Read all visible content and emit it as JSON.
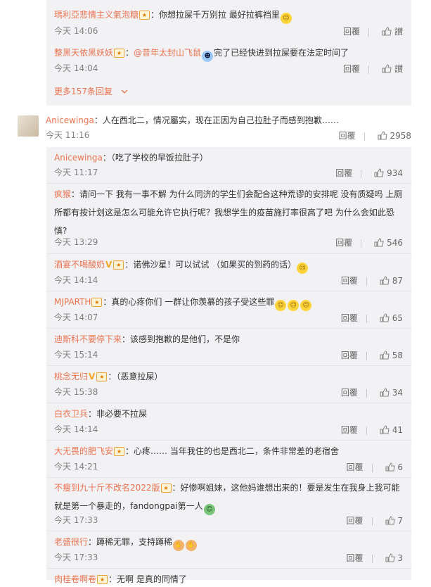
{
  "top_replies": [
    {
      "name": "瑪利亞悲情主义氣泡糖",
      "text": "：你想拉屎千万别拉 最好拉裤裆里",
      "time": "今天 14:06",
      "reply": "回覆",
      "like": "讃"
    },
    {
      "name": "整黑天依黑妖妖",
      "mention": "@昔年太封山飞鼠",
      "text": "完了已经快进到拉屎要在法定时间了",
      "time": "今天 14:04",
      "reply": "回覆",
      "like": "讃"
    }
  ],
  "more_replies": "更多157条回复",
  "main_comment": {
    "name": "Anicewinga",
    "text": "：人在西北二，情况屬实，现在正因为自己拉肚子而感到抱歉……",
    "time": "今天 11:16",
    "reply": "回覆",
    "likes": "2958"
  },
  "sub_replies": [
    {
      "name": "Anicewinga",
      "text": "：（吃了学校的早饭拉肚子）",
      "time": "今天 11:17",
      "reply": "回覆",
      "likes": "934"
    },
    {
      "name": "疯猴",
      "text": "：请问一下 我有一事不解 为什么同济的学生们会配合这种荒谬的安排呢 没有质疑吗 上厕所都有按计划这是怎么可能允许它执行呢？我想学生的疫苗施打率很高了吧 为什么会如此恐慎?",
      "time": "今天 13:29",
      "reply": "回覆",
      "likes": "546"
    },
    {
      "name": "酒宴不喝酸奶",
      "text": "：诺佛沙星！可以试试 （如果买的到药的话）",
      "time": "今天 14:14",
      "reply": "回覆",
      "likes": "87"
    },
    {
      "name": "MJPARTH",
      "text": "：真的心疼你们 一群让你羡慕的孩子受这些罪",
      "time": "今天 14:07",
      "reply": "回覆",
      "likes": "65"
    },
    {
      "name": "迪斯科不要停下来",
      "text": "：该感到抱歉的是他们，不是你",
      "time": "今天 15:14",
      "reply": "回覆",
      "likes": "58"
    },
    {
      "name": "桃念无归",
      "text": "：（恶意拉屎）",
      "time": "今天 15:38",
      "reply": "回覆",
      "likes": "34"
    },
    {
      "name": "白衣卫兵",
      "text": "：非必要不拉屎",
      "time": "今天 14:14",
      "reply": "回覆",
      "likes": "41"
    },
    {
      "name": "大无畏的肥飞安",
      "text": "：心疼…… 当年我住的也是西北二，条件非常差的老宿舍",
      "time": "今天 14:21",
      "reply": "回覆",
      "likes": "6"
    },
    {
      "name": "不瘦到九十斤不改名2022版",
      "text": "：好惨啊姐妹，这他妈谁想出来的！要是发生在我身上我可能就是第一个暴走的，fandongpai第一人",
      "time": "今天 17:33",
      "reply": "回覆",
      "likes": "7"
    },
    {
      "name": "老盛很行",
      "text": "：蹲稀无罪，支持蹲稀",
      "time": "今天 17:33",
      "reply": "回覆",
      "likes": "3"
    },
    {
      "name": "肉桂卷啊卷",
      "text": "：无啊 是真的同情了",
      "time": "",
      "reply": "",
      "likes": ""
    }
  ]
}
